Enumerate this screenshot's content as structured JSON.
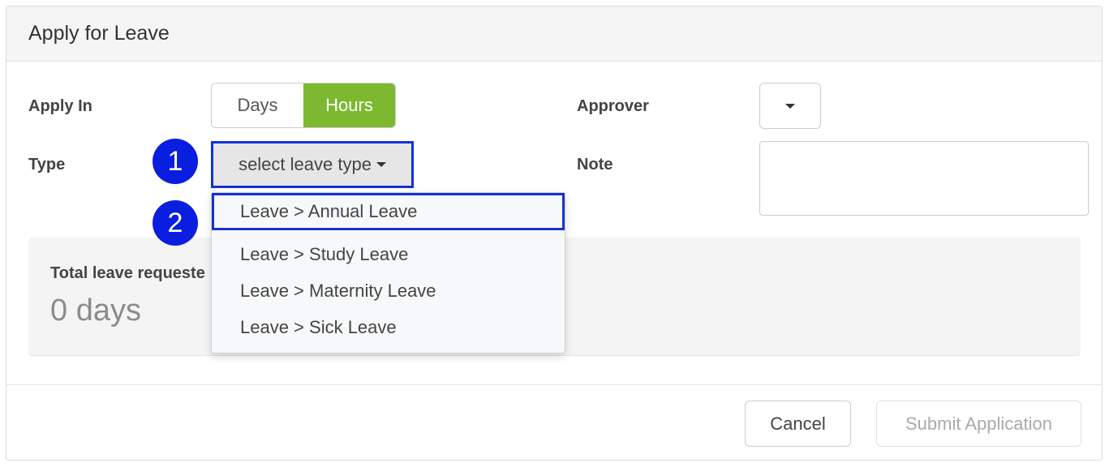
{
  "panel": {
    "title": "Apply for Leave"
  },
  "form": {
    "apply_in_label": "Apply In",
    "apply_in_options": [
      "Days",
      "Hours"
    ],
    "apply_in_selected": "Hours",
    "type_label": "Type",
    "type_select_text": "select leave type",
    "approver_label": "Approver",
    "note_label": "Note",
    "note_value": ""
  },
  "dropdown": {
    "items": [
      "Leave > Annual Leave",
      "Leave > Study Leave",
      "Leave > Maternity Leave",
      "Leave > Sick Leave"
    ],
    "highlighted": "Leave > Annual Leave"
  },
  "summary": {
    "label": "Total leave requeste",
    "value": "0 days"
  },
  "annotations": [
    "1",
    "2"
  ],
  "footer": {
    "cancel_label": "Cancel",
    "submit_label": "Submit Application"
  },
  "colors": {
    "accent_green": "#7cb931",
    "highlight_blue": "#1232d8",
    "badge_blue": "#0a1ee0"
  },
  "icons": {
    "approver_caret": "caret-down-icon",
    "type_caret": "caret-down-icon"
  }
}
